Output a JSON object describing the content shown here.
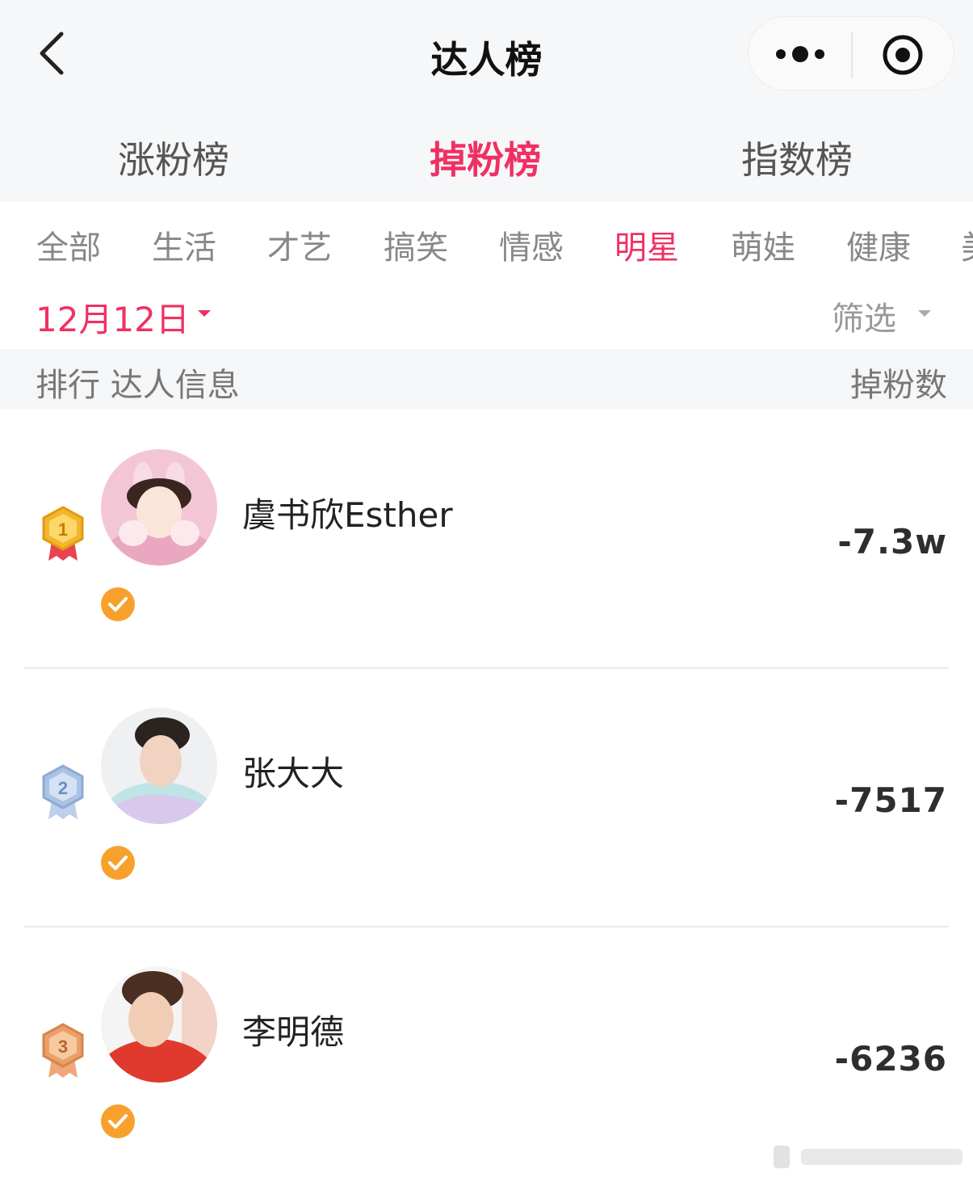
{
  "header": {
    "title": "达人榜"
  },
  "main_tabs": [
    {
      "label": "涨粉榜",
      "active": false
    },
    {
      "label": "掉粉榜",
      "active": true
    },
    {
      "label": "指数榜",
      "active": false
    }
  ],
  "categories": [
    {
      "label": "全部",
      "active": false
    },
    {
      "label": "生活",
      "active": false
    },
    {
      "label": "才艺",
      "active": false
    },
    {
      "label": "搞笑",
      "active": false
    },
    {
      "label": "情感",
      "active": false
    },
    {
      "label": "明星",
      "active": true
    },
    {
      "label": "萌娃",
      "active": false
    },
    {
      "label": "健康",
      "active": false
    },
    {
      "label": "美",
      "active": false
    }
  ],
  "filter_bar": {
    "date": "12月12日",
    "filter_label": "筛选"
  },
  "column_headers": {
    "left": "排行 达人信息",
    "right": "掉粉数"
  },
  "ranking": [
    {
      "rank": "1",
      "name": "虞书欣Esther",
      "count": "-7.3w",
      "verified": true
    },
    {
      "rank": "2",
      "name": "张大大",
      "count": "-7517",
      "verified": true
    },
    {
      "rank": "3",
      "name": "李明德",
      "count": "-6236",
      "verified": true
    }
  ],
  "colors": {
    "accent": "#f03063",
    "verified": "#f7a12c",
    "gold": "#f3b52e",
    "silver": "#a9c3e4",
    "bronze": "#eaa06a"
  }
}
